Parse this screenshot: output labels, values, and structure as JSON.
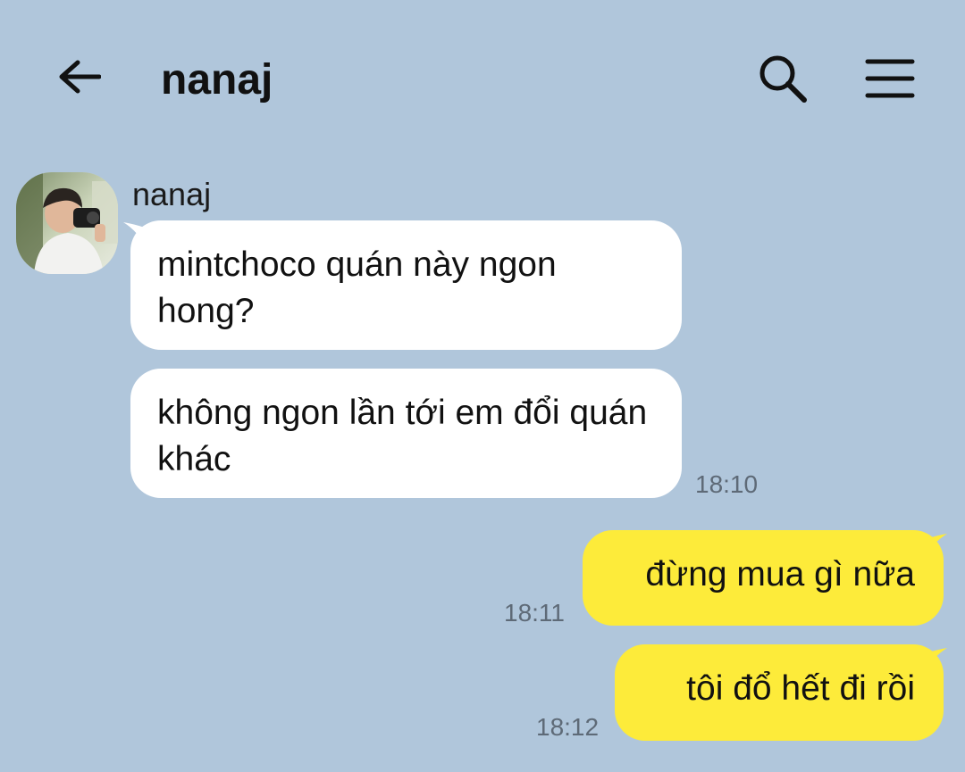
{
  "header": {
    "title": "nanaj",
    "back_icon": "arrow-left-icon",
    "search_icon": "search-icon",
    "menu_icon": "menu-icon"
  },
  "colors": {
    "background": "#b0c6db",
    "incoming_bubble": "#ffffff",
    "outgoing_bubble": "#fdeb3a",
    "timestamp": "#5e6a77"
  },
  "conversation": {
    "sender_name": "nanaj",
    "messages": [
      {
        "direction": "incoming",
        "text": "mintchoco quán này ngon hong?",
        "time": ""
      },
      {
        "direction": "incoming",
        "text": "không ngon lần tới em đổi quán khác",
        "time": "18:10"
      },
      {
        "direction": "outgoing",
        "text": "đừng mua gì nữa",
        "time": "18:11"
      },
      {
        "direction": "outgoing",
        "text": "tôi đổ hết đi rồi",
        "time": "18:12"
      }
    ]
  }
}
